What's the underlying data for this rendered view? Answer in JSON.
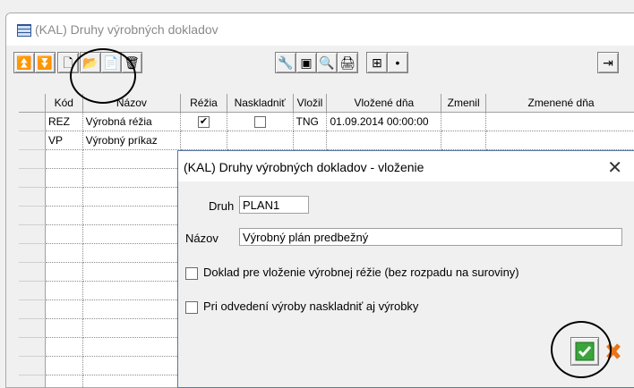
{
  "window": {
    "title": "(KAL) Druhy výrobných dokladov"
  },
  "toolbar": {
    "buttons": [
      "first-record-icon",
      "last-record-icon",
      "new-document-icon",
      "edit-folder-icon",
      "copy-icon",
      "delete-icon",
      "wrench-icon",
      "monitor-icon",
      "search-icon",
      "print-icon",
      "grid-settings-icon",
      "info-icon",
      "exit-icon"
    ]
  },
  "grid": {
    "columns": [
      "Kód",
      "Názov",
      "Réžia",
      "Naskladniť",
      "Vložil",
      "Vložené dňa",
      "Zmenil",
      "Zmenené dňa"
    ],
    "rows": [
      {
        "kod": "REZ",
        "nazov": "Výrobná réžia",
        "rezia": true,
        "naskladnit": false,
        "vlozil": "TNG",
        "vlozene": "01.09.2014 00:00:00"
      },
      {
        "kod": "VP",
        "nazov": "Výrobný príkaz"
      }
    ]
  },
  "dialog": {
    "title": "(KAL) Druhy výrobných dokladov - vloženie",
    "druh_label": "Druh",
    "druh_value": "PLAN1",
    "nazov_label": "Názov",
    "nazov_value": "Výrobný plán predbežný",
    "check1": "Doklad pre vloženie výrobnej réžie (bez rozpadu na suroviny)",
    "check2": "Pri odvedení výroby naskladniť aj výrobky",
    "close_symbol": "✕"
  },
  "colors": {
    "ok_green": "#3aa53a",
    "cancel_orange": "#e8731a"
  }
}
